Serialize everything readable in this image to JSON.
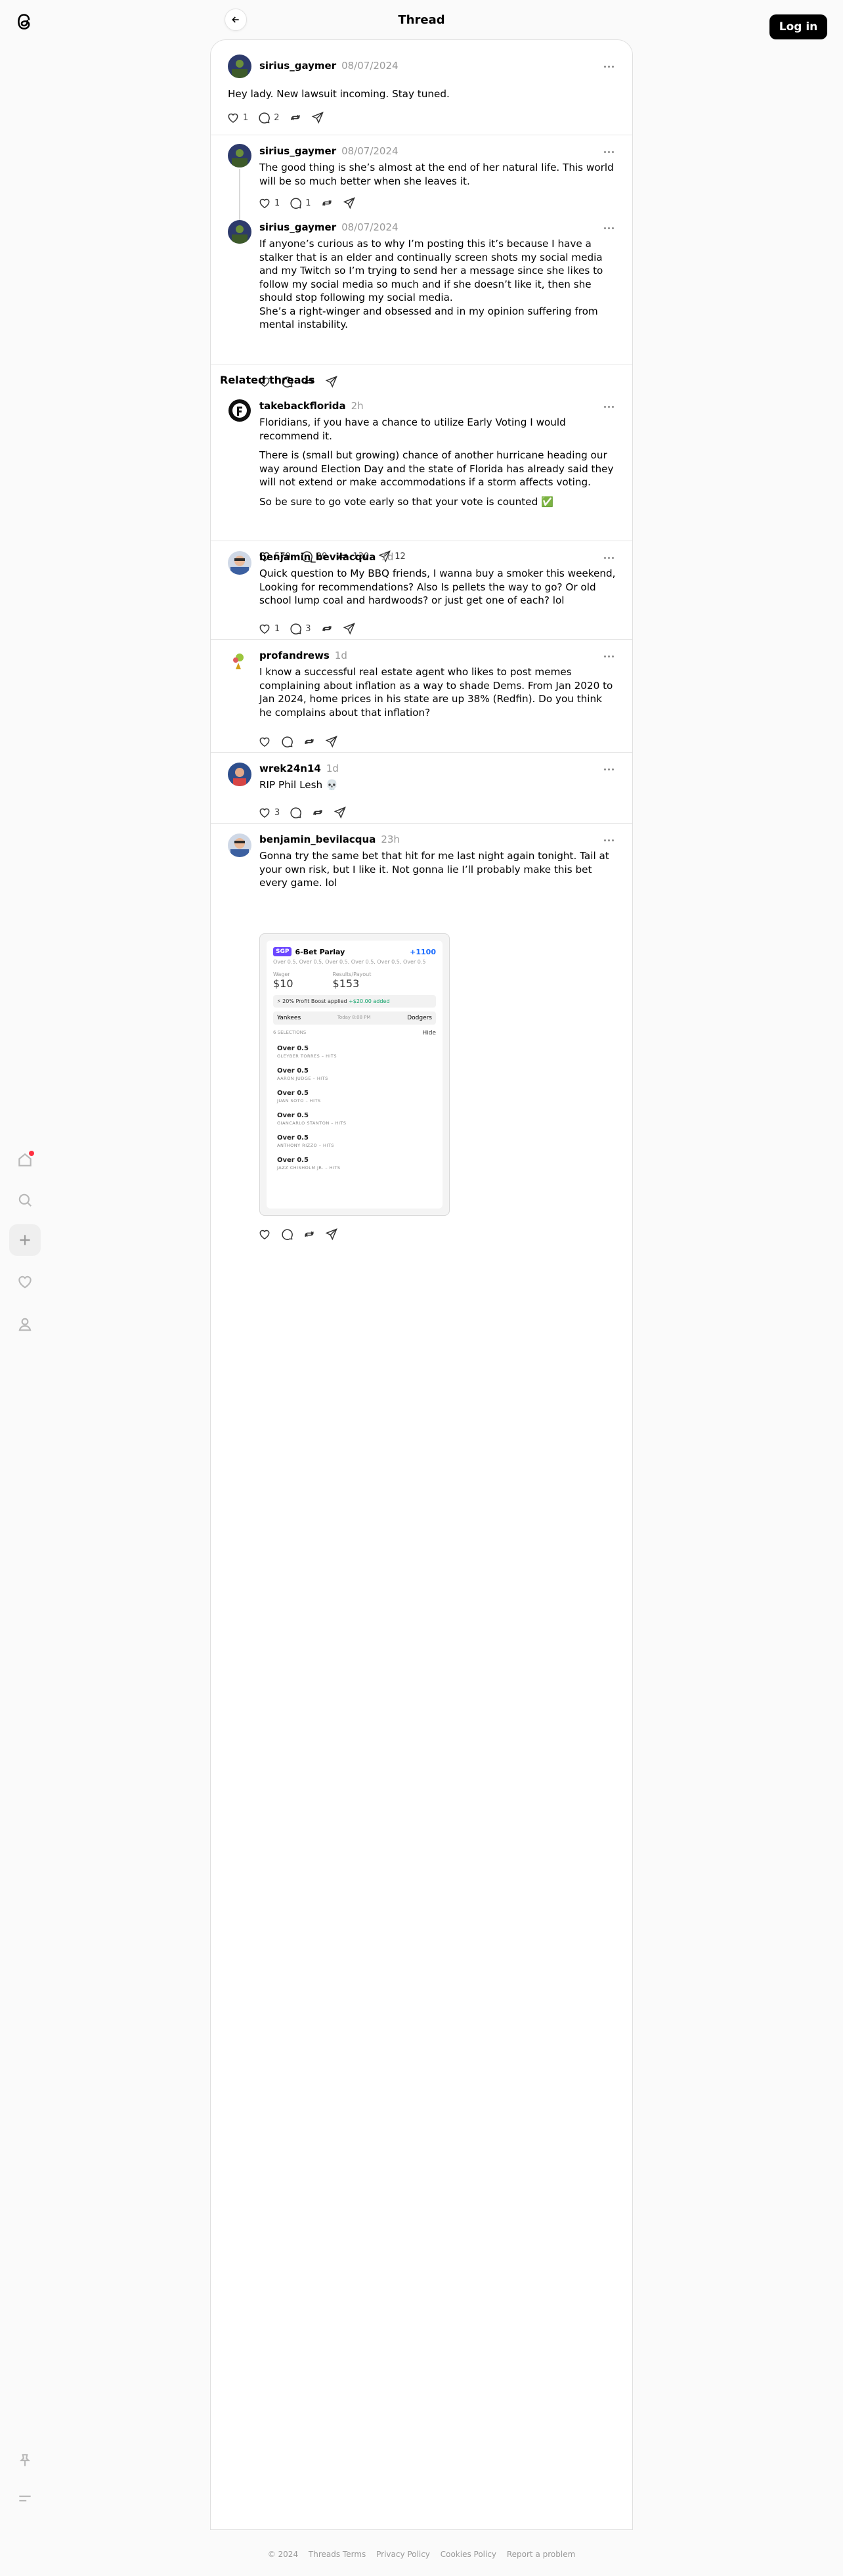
{
  "header": {
    "title": "Thread",
    "login_label": "Log in"
  },
  "main_post": {
    "username": "sirius_gaymer",
    "date": "08/07/2024",
    "text": "Hey lady. New lawsuit incoming. Stay tuned.",
    "likes": "1",
    "replies": "2"
  },
  "replies": [
    {
      "username": "sirius_gaymer",
      "date": "08/07/2024",
      "text": "The good thing is she’s almost at the end of her natural life. This world will be so much better when she leaves it.",
      "likes": "1",
      "replies": "1"
    },
    {
      "username": "sirius_gaymer",
      "date": "08/07/2024",
      "text": "If anyone’s curious as to why I’m posting this it’s because I have a stalker that is an elder and continually screen shots my social media and my Twitch so I’m trying to send her a message since she likes to follow my social media so much and if she doesn’t like it, then she should stop following my social media.",
      "text2": "She’s a right-winger and obsessed and in my opinion suffering from mental instability."
    }
  ],
  "related": {
    "title": "Related threads",
    "posts": [
      {
        "username": "takebackflorida",
        "time": "2h",
        "p1": "Floridians, if you have a chance to utilize Early Voting I would recommend it.",
        "p2": "There is (small but growing) chance of another hurricane heading our way around Election Day and the state of Florida has already said they will not extend or make accommodations if a storm affects voting.",
        "p3": "So be sure to go vote early so that your vote is counted ✅",
        "likes": "579",
        "replies": "29",
        "reposts": "130",
        "shares": "12"
      },
      {
        "username": "benjamin_bevilacqua",
        "time": "1d",
        "text": "Quick question to My BBQ friends, I wanna buy a smoker this weekend, Looking for recommendations? Also Is pellets the way to go? Or old school lump coal and hardwoods? or just get one of each? lol",
        "likes": "1",
        "replies": "3"
      },
      {
        "username": "profandrews",
        "time": "1d",
        "text": "I know a successful real estate agent who likes to post memes complaining about inflation as a way to shade Dems. From Jan 2020 to Jan 2024, home prices in his state are up 38% (Redfin). Do you think he complains about that inflation?"
      },
      {
        "username": "wrek24n14",
        "time": "1d",
        "text": "RIP Phil Lesh 💀",
        "likes": "3"
      },
      {
        "username": "benjamin_bevilacqua",
        "time": "23h",
        "text": "Gonna try the same bet that hit for me last night again tonight. Tail at your own risk, but I like it. Not gonna lie I’ll probably make this bet every game. lol",
        "slip": {
          "tag": "SGP",
          "title": "6-Bet Parlay",
          "odds": "+1100",
          "legs_line": "Over 0.5, Over 0.5, Over 0.5, Over 0.5, Over 0.5, Over 0.5",
          "wager_label": "Wager",
          "wager": "$10",
          "payout_label": "Results/Payout",
          "payout": "$153",
          "boost": "20% Profit Boost applied",
          "boost_amt": "+$20.00 added",
          "team1": "Yankees",
          "team2": "Dodgers",
          "match_time": "Today 8:08 PM",
          "hide_label": "6 SELECTIONS",
          "hide_btn": "Hide",
          "legs": [
            {
              "t": "Over 0.5",
              "s": "GLEYBER TORRES – HITS"
            },
            {
              "t": "Over 0.5",
              "s": "AARON JUDGE – HITS"
            },
            {
              "t": "Over 0.5",
              "s": "JUAN SOTO – HITS"
            },
            {
              "t": "Over 0.5",
              "s": "GIANCARLO STANTON – HITS"
            },
            {
              "t": "Over 0.5",
              "s": "ANTHONY RIZZO – HITS"
            },
            {
              "t": "Over 0.5",
              "s": "JAZZ CHISHOLM JR. – HITS"
            }
          ]
        }
      }
    ]
  },
  "footer": {
    "copyright": "© 2024",
    "links": [
      "Threads Terms",
      "Privacy Policy",
      "Cookies Policy",
      "Report a problem"
    ]
  },
  "icons": {
    "logo": "threads-logo-icon",
    "home": "home-icon",
    "search": "search-icon",
    "create": "plus-icon",
    "activity": "heart-icon",
    "profile": "person-icon",
    "pin": "pin-icon",
    "menu": "menu-icon"
  }
}
